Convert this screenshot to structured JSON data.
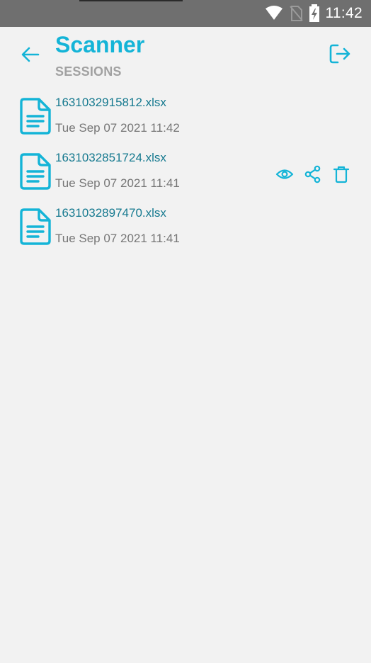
{
  "status_bar": {
    "time": "11:42",
    "icons": [
      "wifi-icon",
      "no-sim-icon",
      "battery-charging-icon"
    ]
  },
  "header": {
    "back_icon": "arrow-left-icon",
    "title": "Scanner",
    "subtitle": "SESSIONS",
    "logout_icon": "logout-icon"
  },
  "colors": {
    "accent": "#14b4d7",
    "file_name": "#15798f",
    "subtitle": "#a1a1a1",
    "date": "#767676",
    "background": "#f2f2f2",
    "status_bar": "#6f6f6f"
  },
  "sessions": [
    {
      "file_name": "1631032915812.xlsx",
      "date": "Tue Sep 07 2021 11:42",
      "icon": "document-icon"
    },
    {
      "file_name": "1631032851724.xlsx",
      "date": "Tue Sep 07 2021 11:41",
      "icon": "document-icon",
      "actions": [
        "eye-icon",
        "share-icon",
        "trash-icon"
      ]
    },
    {
      "file_name": "1631032897470.xlsx",
      "date": "Tue Sep 07 2021 11:41",
      "icon": "document-icon"
    }
  ]
}
